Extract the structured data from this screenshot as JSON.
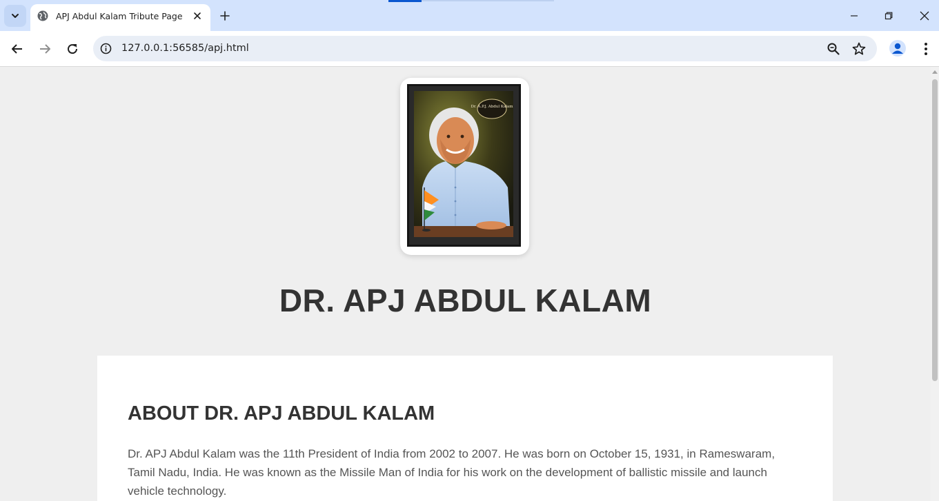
{
  "browser": {
    "tab_title": "APJ Abdul Kalam Tribute Page",
    "url": "127.0.0.1:56585/apj.html"
  },
  "page": {
    "portrait_caption": "Dr. A.P.J. Abdul Kalam",
    "title": "DR. APJ ABDUL KALAM",
    "about": {
      "heading": "ABOUT DR. APJ ABDUL KALAM",
      "paragraph": "Dr. APJ Abdul Kalam was the 11th President of India from 2002 to 2007. He was born on October 15, 1931, in Rameswaram, Tamil Nadu, India. He was known as the Missile Man of India for his work on the development of ballistic missile and launch vehicle technology."
    }
  },
  "icons": {
    "tab_search": "chevron-down-icon",
    "favicon": "globe-icon",
    "tab_close": "close-icon",
    "new_tab": "plus-icon",
    "back": "back-arrow-icon",
    "forward": "forward-arrow-icon",
    "reload": "reload-icon",
    "site_info": "info-icon",
    "zoom": "zoom-icon",
    "bookmark": "star-icon",
    "profile": "profile-icon",
    "menu": "kebab-menu-icon",
    "minimize": "minimize-icon",
    "restore": "restore-icon",
    "close_window": "close-icon"
  },
  "colors": {
    "tabstrip": "#d3e3fd",
    "page_background": "#efefef",
    "heading_text": "#333333",
    "body_text": "#555555"
  }
}
